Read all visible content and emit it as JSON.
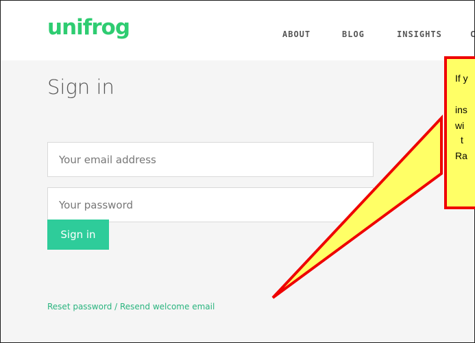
{
  "brand": {
    "logo_text": "unifrog",
    "accent_color": "#2ecc71"
  },
  "nav": {
    "items": [
      "ABOUT",
      "BLOG",
      "INSIGHTS",
      "C"
    ]
  },
  "signin": {
    "title": "Sign in",
    "email_placeholder": "Your email address",
    "password_placeholder": "Your password",
    "button_label": "Sign in",
    "button_color": "#2ecc9a",
    "reset_link": "Reset password / Resend welcome email"
  },
  "callout": {
    "lines": [
      "If y",
      "ins",
      "wi",
      "t",
      "Ra"
    ],
    "fill_color": "#ffff66",
    "border_color": "#ee0000"
  }
}
